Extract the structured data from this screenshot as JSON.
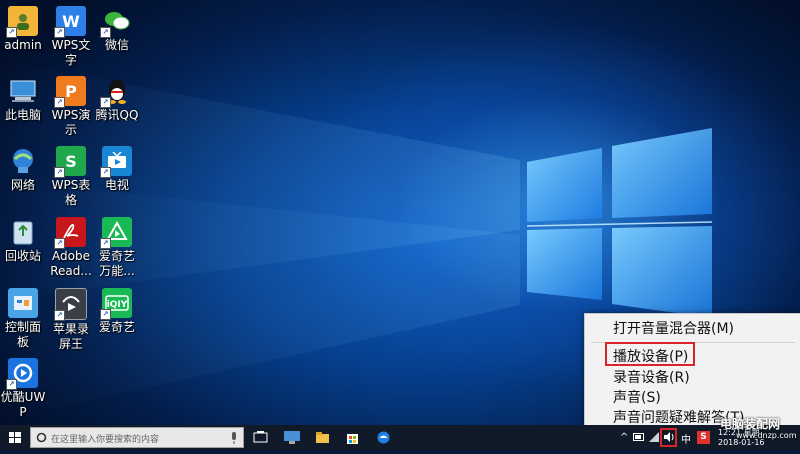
{
  "desktop": {
    "icons": [
      {
        "label": "admin",
        "icon": "user-folder-icon",
        "color": "#f2b53a"
      },
      {
        "label": "此电脑",
        "icon": "computer-icon",
        "color": "#3a8fd8"
      },
      {
        "label": "网络",
        "icon": "network-icon",
        "color": "#2f83d6"
      },
      {
        "label": "回收站",
        "icon": "recycle-bin-icon",
        "color": "#9fc6e8"
      },
      {
        "label": "控制面板",
        "icon": "control-panel-icon",
        "color": "#4aa3e6"
      },
      {
        "label": "优酷UWP",
        "icon": "youku-icon",
        "color": "#1a74e0"
      },
      {
        "label": "WPS文字",
        "icon": "wps-writer-icon",
        "color": "#2c80e8"
      },
      {
        "label": "WPS演示",
        "icon": "wps-presentation-icon",
        "color": "#f07a1e"
      },
      {
        "label": "WPS表格",
        "icon": "wps-spreadsheet-icon",
        "color": "#1fa84c"
      },
      {
        "label": "Adobe Read...",
        "icon": "adobe-reader-icon",
        "color": "#c8161d"
      },
      {
        "label": "苹果录屏王",
        "icon": "screen-recorder-icon",
        "color": "#3a3f47"
      },
      {
        "label": "微信",
        "icon": "wechat-icon",
        "color": "#3bb43a"
      },
      {
        "label": "腾讯QQ",
        "icon": "qq-icon",
        "color": "#111111"
      },
      {
        "label": "电视",
        "icon": "tv-icon",
        "color": "#1a86d6"
      },
      {
        "label": "爱奇艺万能...",
        "icon": "iqiyi-player-icon",
        "color": "#19b955"
      },
      {
        "label": "爱奇艺",
        "icon": "iqiyi-icon",
        "color": "#19b955"
      }
    ]
  },
  "context_menu": {
    "items": [
      "打开音量混合器(M)",
      "播放设备(P)",
      "录音设备(R)",
      "声音(S)",
      "声音问题疑难解答(T)"
    ],
    "highlight_color": "#d8242a"
  },
  "taskbar": {
    "search_placeholder": "在这里输入你要搜索的内容",
    "ime": "中",
    "time": "12:21 星期",
    "date": "2018-01-16"
  },
  "watermark": {
    "line1": "电脑装配网",
    "line2": "www.dnzp.com"
  }
}
